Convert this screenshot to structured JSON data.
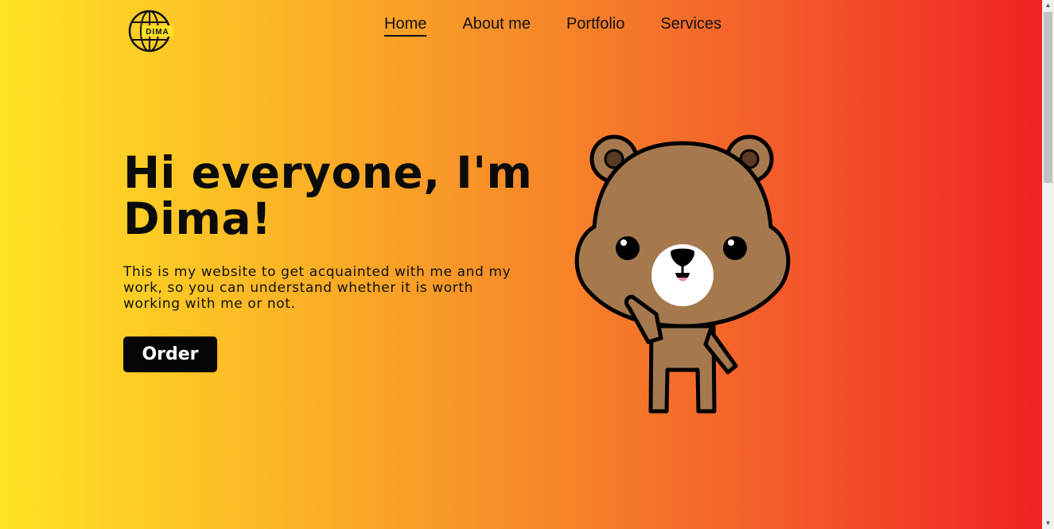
{
  "header": {
    "logo_text": "DIMA",
    "nav": [
      {
        "label": "Home",
        "active": true
      },
      {
        "label": "About me",
        "active": false
      },
      {
        "label": "Portfolio",
        "active": false
      },
      {
        "label": "Services",
        "active": false
      }
    ]
  },
  "hero": {
    "title": "Hi everyone, I'm Dima!",
    "description": "This is my website to get acquainted with me and my work, so you can understand whether it is worth working with me or not.",
    "order_label": "Order"
  },
  "colors": {
    "gradient_start": "#ffe324",
    "gradient_end": "#f02222",
    "button_bg": "#050505",
    "bear_fur": "#a5784e"
  },
  "icons": {
    "logo": "globe-icon",
    "illustration": "bear-mascot",
    "scroll_up": "arrow-up-icon",
    "scroll_down": "arrow-down-icon"
  }
}
